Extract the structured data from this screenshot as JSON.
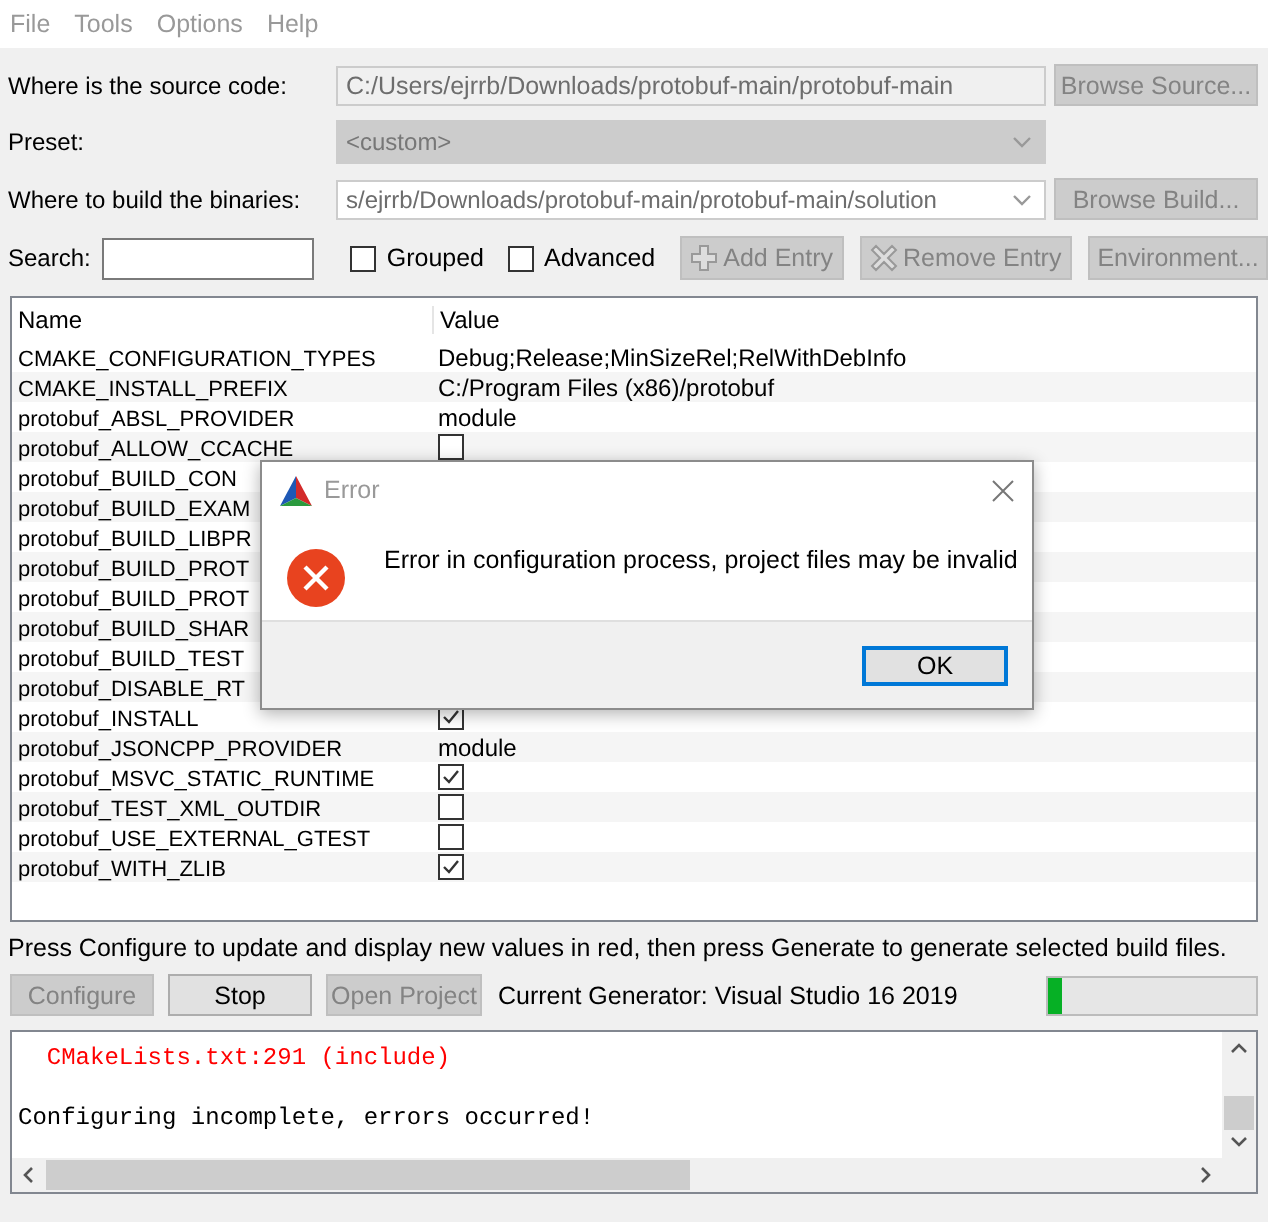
{
  "menu": [
    {
      "label": "File"
    },
    {
      "label": "Tools"
    },
    {
      "label": "Options"
    },
    {
      "label": "Help"
    }
  ],
  "form": {
    "source": {
      "label": "Where is the source code:",
      "value": "C:/Users/ejrrb/Downloads/protobuf-main/protobuf-main",
      "button": "Browse Source...",
      "disabled": true
    },
    "preset": {
      "label": "Preset:",
      "value": "<custom>"
    },
    "build": {
      "label": "Where to build the binaries:",
      "value": "s/ejrrb/Downloads/protobuf-main/protobuf-main/solution",
      "button": "Browse Build...",
      "disabled": true
    }
  },
  "search_bar": {
    "label": "Search:",
    "grouped": {
      "label": "Grouped",
      "checked": false
    },
    "advanced": {
      "label": "Advanced",
      "checked": false
    },
    "buttons": [
      {
        "kind": "add",
        "label": "Add Entry",
        "disabled": true
      },
      {
        "kind": "remove",
        "label": "Remove Entry",
        "disabled": true
      },
      {
        "kind": "plain",
        "label": "Environment...",
        "disabled": true
      }
    ]
  },
  "table": {
    "columns": [
      "Name",
      "Value"
    ],
    "rows": [
      {
        "name": "CMAKE_CONFIGURATION_TYPES",
        "kind": "text",
        "value": "Debug;Release;MinSizeRel;RelWithDebInfo"
      },
      {
        "name": "CMAKE_INSTALL_PREFIX",
        "kind": "text",
        "value": "C:/Program Files (x86)/protobuf"
      },
      {
        "name": "protobuf_ABSL_PROVIDER",
        "kind": "text",
        "value": "module"
      },
      {
        "name": "protobuf_ALLOW_CCACHE",
        "kind": "check",
        "checked": false
      },
      {
        "name": "protobuf_BUILD_CON"
      },
      {
        "name": "protobuf_BUILD_EXAM"
      },
      {
        "name": "protobuf_BUILD_LIBPR"
      },
      {
        "name": "protobuf_BUILD_PROT"
      },
      {
        "name": "protobuf_BUILD_PROT"
      },
      {
        "name": "protobuf_BUILD_SHAR"
      },
      {
        "name": "protobuf_BUILD_TEST"
      },
      {
        "name": "protobuf_DISABLE_RT"
      },
      {
        "name": "protobuf_INSTALL",
        "kind": "check",
        "checked": true
      },
      {
        "name": "protobuf_JSONCPP_PROVIDER",
        "kind": "text",
        "value": "module"
      },
      {
        "name": "protobuf_MSVC_STATIC_RUNTIME",
        "kind": "check",
        "checked": true
      },
      {
        "name": "protobuf_TEST_XML_OUTDIR",
        "kind": "check",
        "checked": false
      },
      {
        "name": "protobuf_USE_EXTERNAL_GTEST",
        "kind": "check",
        "checked": false
      },
      {
        "name": "protobuf_WITH_ZLIB",
        "kind": "check",
        "checked": true
      }
    ]
  },
  "hint": "Press Configure to update and display new values in red, then press Generate to generate selected build files.",
  "actions": [
    {
      "label": "Configure",
      "disabled": true
    },
    {
      "label": "Stop",
      "disabled": false
    },
    {
      "label": "Open Project",
      "disabled": true
    }
  ],
  "generator": "Current Generator: Visual Studio 16 2019",
  "progress": {
    "level": 0.07
  },
  "output": [
    {
      "kind": "error",
      "text": "  CMakeLists.txt:291 (include)"
    },
    {
      "kind": "normal",
      "text": "Configuring incomplete, errors occurred!"
    }
  ],
  "dialog": {
    "title": "Error",
    "message": "Error in configuration process, project files may be invalid",
    "button": "OK"
  }
}
